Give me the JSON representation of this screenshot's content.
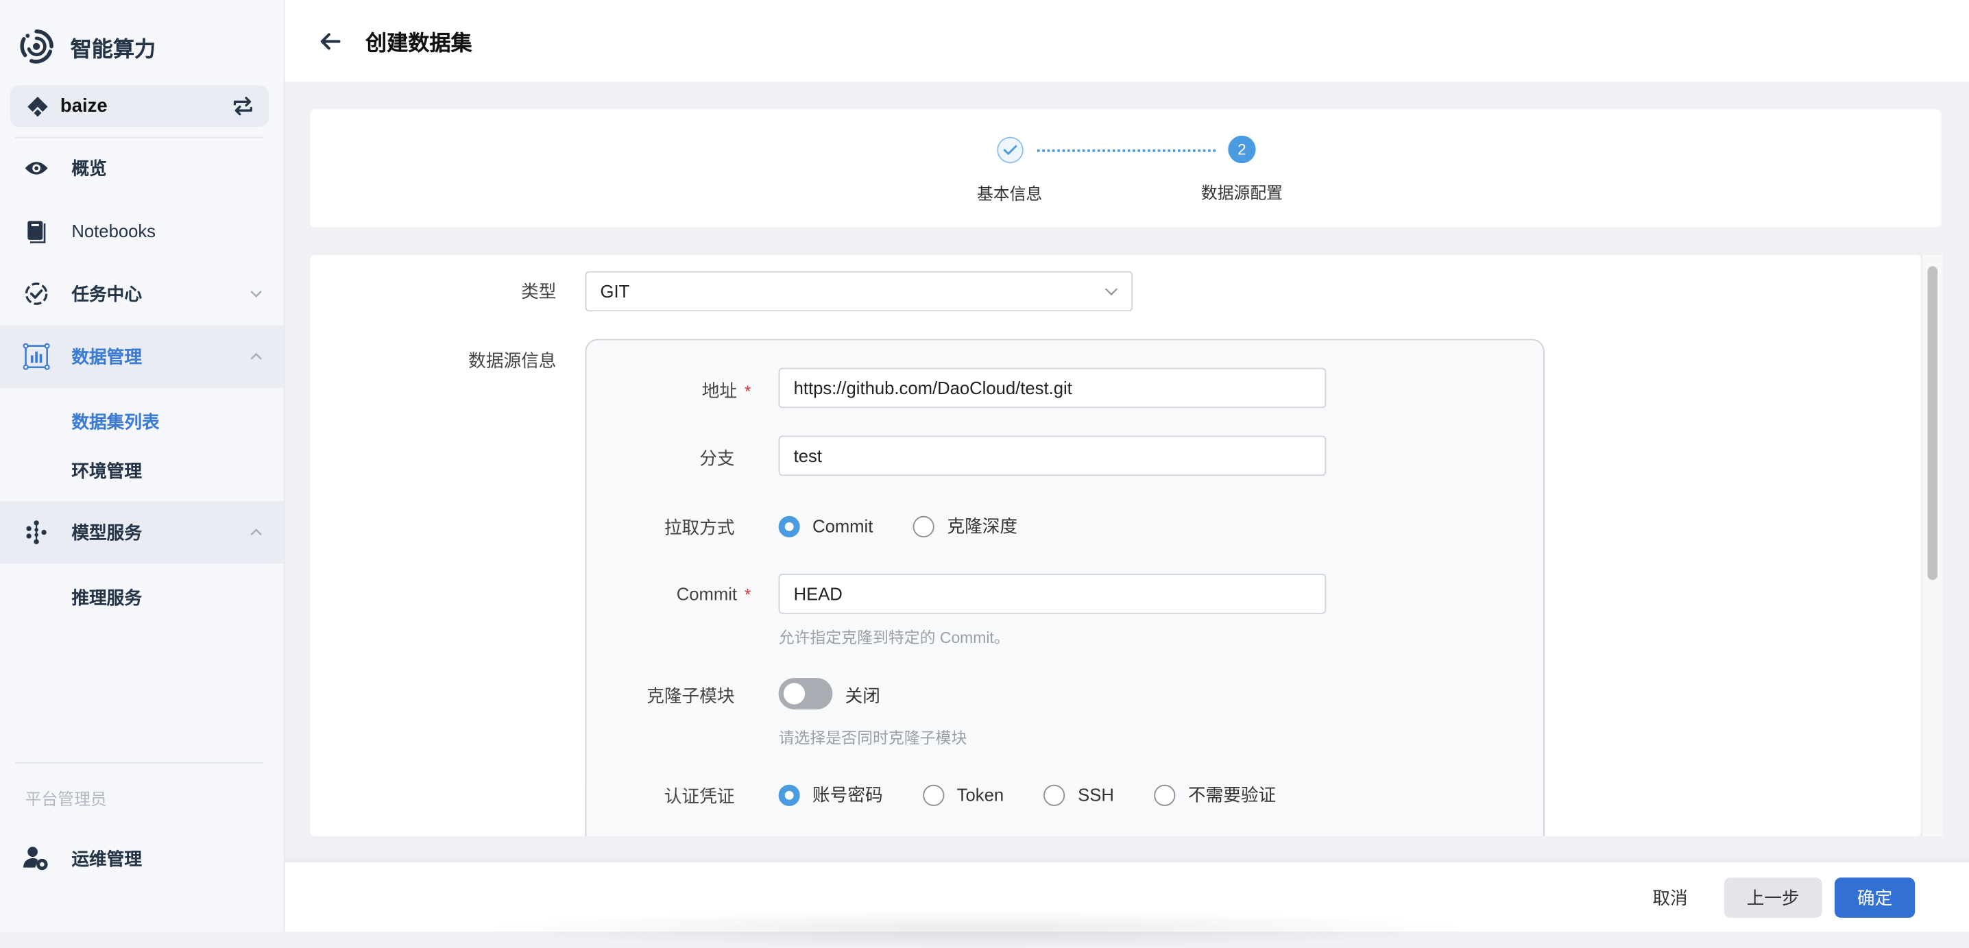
{
  "app": {
    "title": "智能算力"
  },
  "workspace": {
    "name": "baize",
    "icon": "workspace-diamond-icon",
    "switch_icon": "switch-icon"
  },
  "sidebar": {
    "items": [
      {
        "label": "概览",
        "icon": "eye-icon"
      },
      {
        "label": "Notebooks",
        "icon": "notebook-icon"
      },
      {
        "label": "任务中心",
        "icon": "task-check-icon",
        "expanded": false
      },
      {
        "label": "数据管理",
        "icon": "data-chart-icon",
        "expanded": true,
        "active": true,
        "children": [
          {
            "label": "数据集列表",
            "active": true
          },
          {
            "label": "环境管理"
          }
        ]
      },
      {
        "label": "模型服务",
        "icon": "model-nodes-icon",
        "expanded": true,
        "children": [
          {
            "label": "推理服务"
          }
        ]
      }
    ],
    "section_label": "平台管理员",
    "admin_item": {
      "label": "运维管理",
      "icon": "user-gear-icon"
    }
  },
  "header": {
    "title": "创建数据集",
    "back_icon": "arrow-left-icon"
  },
  "stepper": {
    "steps": [
      {
        "label": "基本信息",
        "status": "done"
      },
      {
        "label": "数据源配置",
        "status": "current",
        "number": "2"
      }
    ]
  },
  "form": {
    "type": {
      "label": "类型",
      "value": "GIT"
    },
    "source_info_label": "数据源信息",
    "address": {
      "label": "地址",
      "value": "https://github.com/DaoCloud/test.git",
      "required": true
    },
    "branch": {
      "label": "分支",
      "value": "test"
    },
    "pull_method": {
      "label": "拉取方式",
      "options": [
        "Commit",
        "克隆深度"
      ],
      "selected": "Commit"
    },
    "commit": {
      "label": "Commit",
      "value": "HEAD",
      "required": true,
      "hint": "允许指定克隆到特定的 Commit。"
    },
    "submodules": {
      "label": "克隆子模块",
      "state_label": "关闭",
      "enabled": false,
      "hint": "请选择是否同时克隆子模块"
    },
    "auth": {
      "label": "认证凭证",
      "options": [
        "账号密码",
        "Token",
        "SSH",
        "不需要验证"
      ],
      "selected": "账号密码"
    },
    "required_mark": "*"
  },
  "footer": {
    "cancel": "取消",
    "prev": "上一步",
    "confirm": "确定"
  },
  "colors": {
    "accent": "#3b7bd4",
    "primary_button": "#3370d4",
    "radio_checked": "#4a9be0",
    "required": "#e03131"
  }
}
